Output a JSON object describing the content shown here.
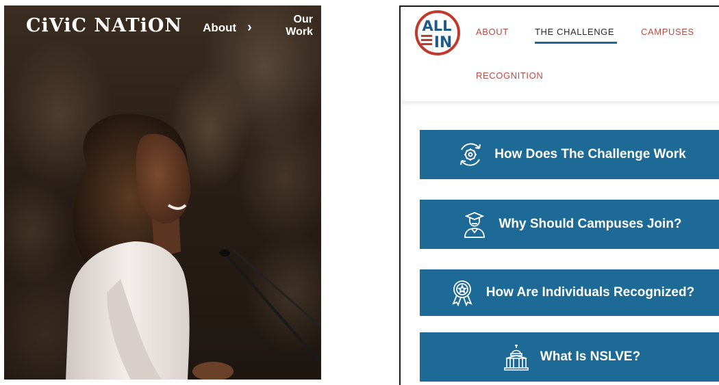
{
  "civic": {
    "logo": "CiViC NATiON",
    "nav_about": "About",
    "nav_chevron": "›",
    "nav_our_work": "Our Work"
  },
  "allin": {
    "logo_text_top": "ALL",
    "logo_text_bottom": "IN",
    "nav": [
      {
        "label": "ABOUT"
      },
      {
        "label": "THE CHALLENGE"
      },
      {
        "label": "CAMPUSES"
      },
      {
        "label": "RECOGNITION"
      }
    ],
    "buttons": [
      {
        "label": "How Does The Challenge Work",
        "icon": "gear-cycle-icon"
      },
      {
        "label": "Why Should Campuses Join?",
        "icon": "graduate-icon"
      },
      {
        "label": "How Are Individuals Recognized?",
        "icon": "award-ribbon-icon"
      },
      {
        "label": "What Is NSLVE?",
        "icon": "capitol-building-icon"
      }
    ],
    "colors": {
      "button_bg": "#1e6a96",
      "nav_text": "#b84a45",
      "logo_red": "#c0392b",
      "logo_blue": "#1e5a8a"
    }
  }
}
